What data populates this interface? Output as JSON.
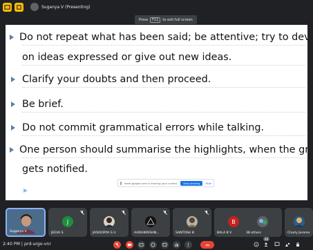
{
  "topbar": {
    "presenter_label": "Suganya V (Presenting)"
  },
  "fullscreen_hint": {
    "prefix": "Press",
    "key": "F11",
    "suffix": "to exit full screen"
  },
  "slide": {
    "bullets": [
      {
        "line1": "Do not repeat what has been said; be attentive; try to develop",
        "line2": "on ideas expressed or give out new ideas."
      },
      {
        "line1": "Clarify your doubts and then proceed."
      },
      {
        "line1": "Be brief."
      },
      {
        "line1": "Do not commit grammatical errors while talking."
      },
      {
        "line1": "One person should summarise the highlights, when the group",
        "line2": "gets notified."
      }
    ]
  },
  "share_bar": {
    "message": "meet.google.com is sharing your screen.",
    "stop_label": "Stop sharing",
    "hide_label": "Hide"
  },
  "participants": [
    {
      "name": "Suganya V",
      "self": true
    },
    {
      "name": "JEEVA S",
      "initial": "J",
      "color": "#1e8e3e"
    },
    {
      "name": "JAISOORYA S U"
    },
    {
      "name": "AADHIKRISHN..."
    },
    {
      "name": "SANTOSH B"
    },
    {
      "name": "BALA B V",
      "initial": "B",
      "color": "#c5221f"
    },
    {
      "name": "38 others"
    },
    {
      "name": "Charly Jerome"
    }
  ],
  "bottombar": {
    "time": "2:40 PM",
    "separator": "|",
    "meeting_code": "prd-urgo-vnr",
    "people_badge": "46"
  },
  "colors": {
    "accent_blue": "#1a73e8",
    "end_call_red": "#ea4335",
    "tile_bg": "#3c4043",
    "topbar_btn": "#fbbc04"
  }
}
